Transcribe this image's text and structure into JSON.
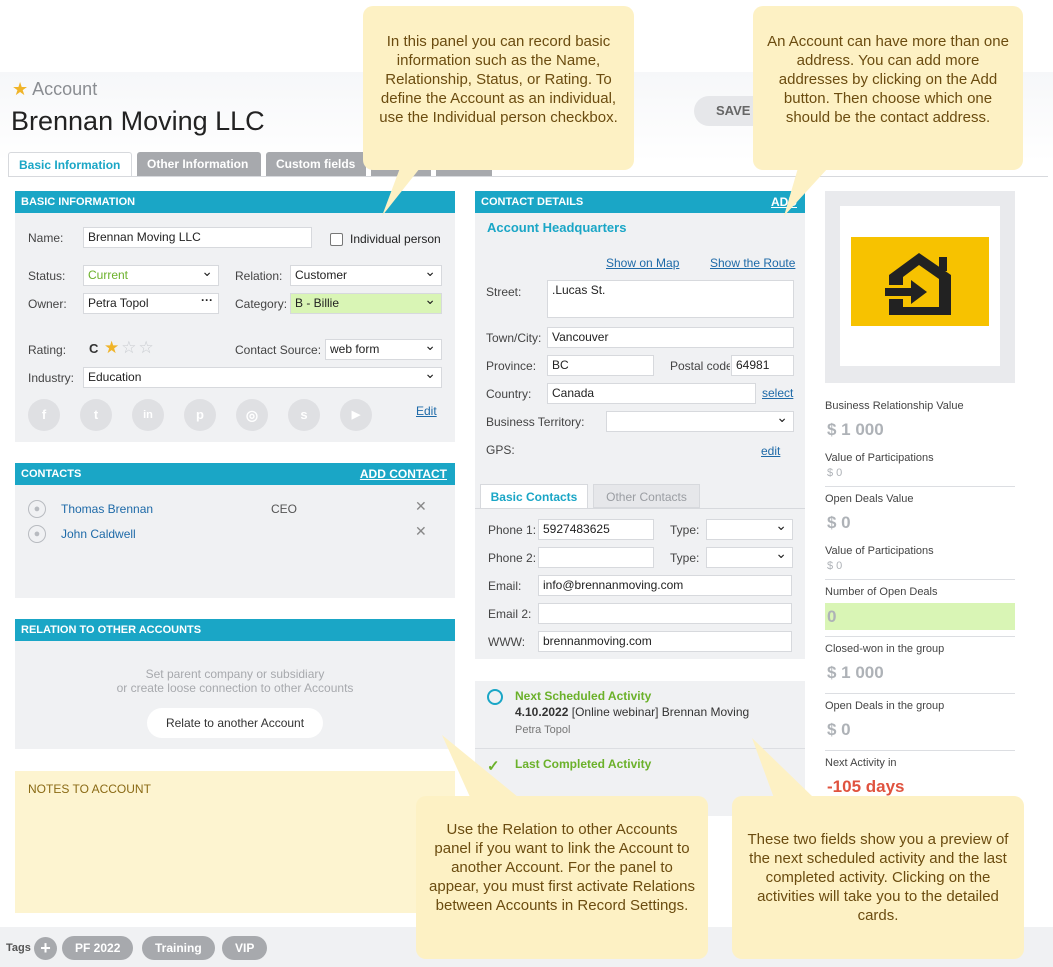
{
  "header": {
    "breadcrumb": "Account",
    "title": "Brennan Moving LLC",
    "save": "SAVE"
  },
  "tabs": [
    "Basic Information",
    "Other Information",
    "Custom fields"
  ],
  "basic": {
    "section": "BASIC INFORMATION",
    "name_label": "Name:",
    "name": "Brennan Moving LLC",
    "individual": "Individual person",
    "status_label": "Status:",
    "status": "Current",
    "relation_label": "Relation:",
    "relation": "Customer",
    "owner_label": "Owner:",
    "owner": "Petra Topol",
    "category_label": "Category:",
    "category": "B - Billie",
    "rating_label": "Rating:",
    "rating": "C",
    "rating_stars": 1,
    "rating_max": 3,
    "source_label": "Contact Source:",
    "source": "web form",
    "industry_label": "Industry:",
    "industry": "Education",
    "socials": [
      "f",
      "t",
      "in",
      "p",
      "ig",
      "s",
      "yt"
    ],
    "edit": "Edit"
  },
  "contacts": {
    "section": "CONTACTS",
    "add": "Add Contact",
    "rows": [
      {
        "name": "Thomas Brennan",
        "role": "CEO"
      },
      {
        "name": "John Caldwell",
        "role": ""
      }
    ]
  },
  "relations": {
    "section": "RELATION TO OTHER ACCOUNTS",
    "hint1": "Set parent company or subsidiary",
    "hint2": "or create loose connection to other Accounts",
    "button": "Relate to another Account"
  },
  "notes": {
    "section": "NOTES TO ACCOUNT"
  },
  "contact_details": {
    "section": "CONTACT DETAILS",
    "add": "Add",
    "address_title": "Account Headquarters",
    "show_map": "Show on Map",
    "show_route": "Show the Route",
    "street_label": "Street:",
    "street": ".Lucas St.",
    "town_label": "Town/City:",
    "town": "Vancouver",
    "province_label": "Province:",
    "province": "BC",
    "postal_label": "Postal code",
    "postal": "64981",
    "country_label": "Country:",
    "country": "Canada",
    "select": "select",
    "territory_label": "Business Territory:",
    "gps_label": "GPS:",
    "gps_edit": "edit"
  },
  "contact_tabs": [
    "Basic Contacts",
    "Other Contacts"
  ],
  "phones": {
    "phone1_label": "Phone 1:",
    "phone1": "5927483625",
    "type_label": "Type:",
    "phone2_label": "Phone 2:",
    "email_label": "Email:",
    "email": "info@brennanmoving.com",
    "email2_label": "Email 2:",
    "www_label": "WWW:",
    "www": "brennanmoving.com"
  },
  "activity": {
    "next_title": "Next Scheduled Activity",
    "next_date": "4.10.2022",
    "next_text": "[Online webinar] Brennan Moving",
    "next_owner": "Petra Topol",
    "last_title": "Last Completed Activity"
  },
  "stats": [
    {
      "label": "Business Relationship Value",
      "value": "$ 1 000"
    },
    {
      "label": "Value of Participations",
      "sub": "$ 0"
    },
    {
      "label": "Open Deals Value",
      "value": "$ 0"
    },
    {
      "label": "Value of Participations",
      "sub": "$ 0"
    },
    {
      "label": "Number of Open Deals",
      "value": "0"
    },
    {
      "label": "Closed-won in the group",
      "value": "$ 1 000"
    },
    {
      "label": "Open Deals in the group",
      "value": "$ 0"
    },
    {
      "label": "Next Activity in",
      "value": "-105 days"
    }
  ],
  "tags": {
    "label": "Tags",
    "items": [
      "PF 2022",
      "Training",
      "VIP"
    ]
  },
  "tips": [
    "In this panel you can record basic information such as the Name, Relationship, Status, or Rating. To define the Account as an individual, use the Individual person checkbox.",
    "An Account can have more than one address. You can add more addresses by clicking on the Add button. Then choose which one should be the contact address.",
    "Use the Relation to other Accounts panel if you want to link the Account to another Account. For the panel to appear, you must first activate Relations between Accounts in Record Settings.",
    "These two fields show you a preview of the next scheduled activity and the last completed activity. Clicking on the activities will take you to the detailed cards."
  ],
  "colors": {
    "accent": "#1aa6c6",
    "star": "#f0b429",
    "tip_bg": "#fdf1c4",
    "overdue": "#e0533f",
    "green": "#6bb12a"
  }
}
